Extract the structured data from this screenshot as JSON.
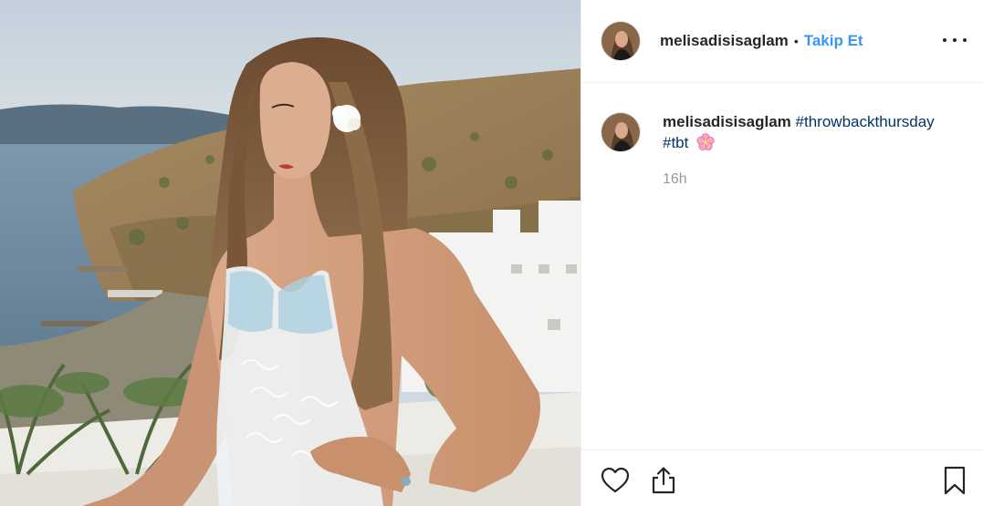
{
  "post": {
    "username": "melisadisisaglam",
    "separator": "•",
    "follow_label": "Takip Et",
    "more_icon": "more-dots-icon"
  },
  "comment": {
    "username": "melisadisisaglam",
    "hashtag_1": "#throwbackthursday",
    "hashtag_2": "#tbt",
    "emoji": "cherry-blossom-emoji",
    "time": "16h"
  },
  "actions": {
    "like_icon": "heart-icon",
    "share_icon": "share-icon",
    "save_icon": "bookmark-icon"
  },
  "colors": {
    "link_blue": "#3897f0",
    "hashtag": "#003569",
    "muted": "#999999",
    "text": "#262626"
  }
}
